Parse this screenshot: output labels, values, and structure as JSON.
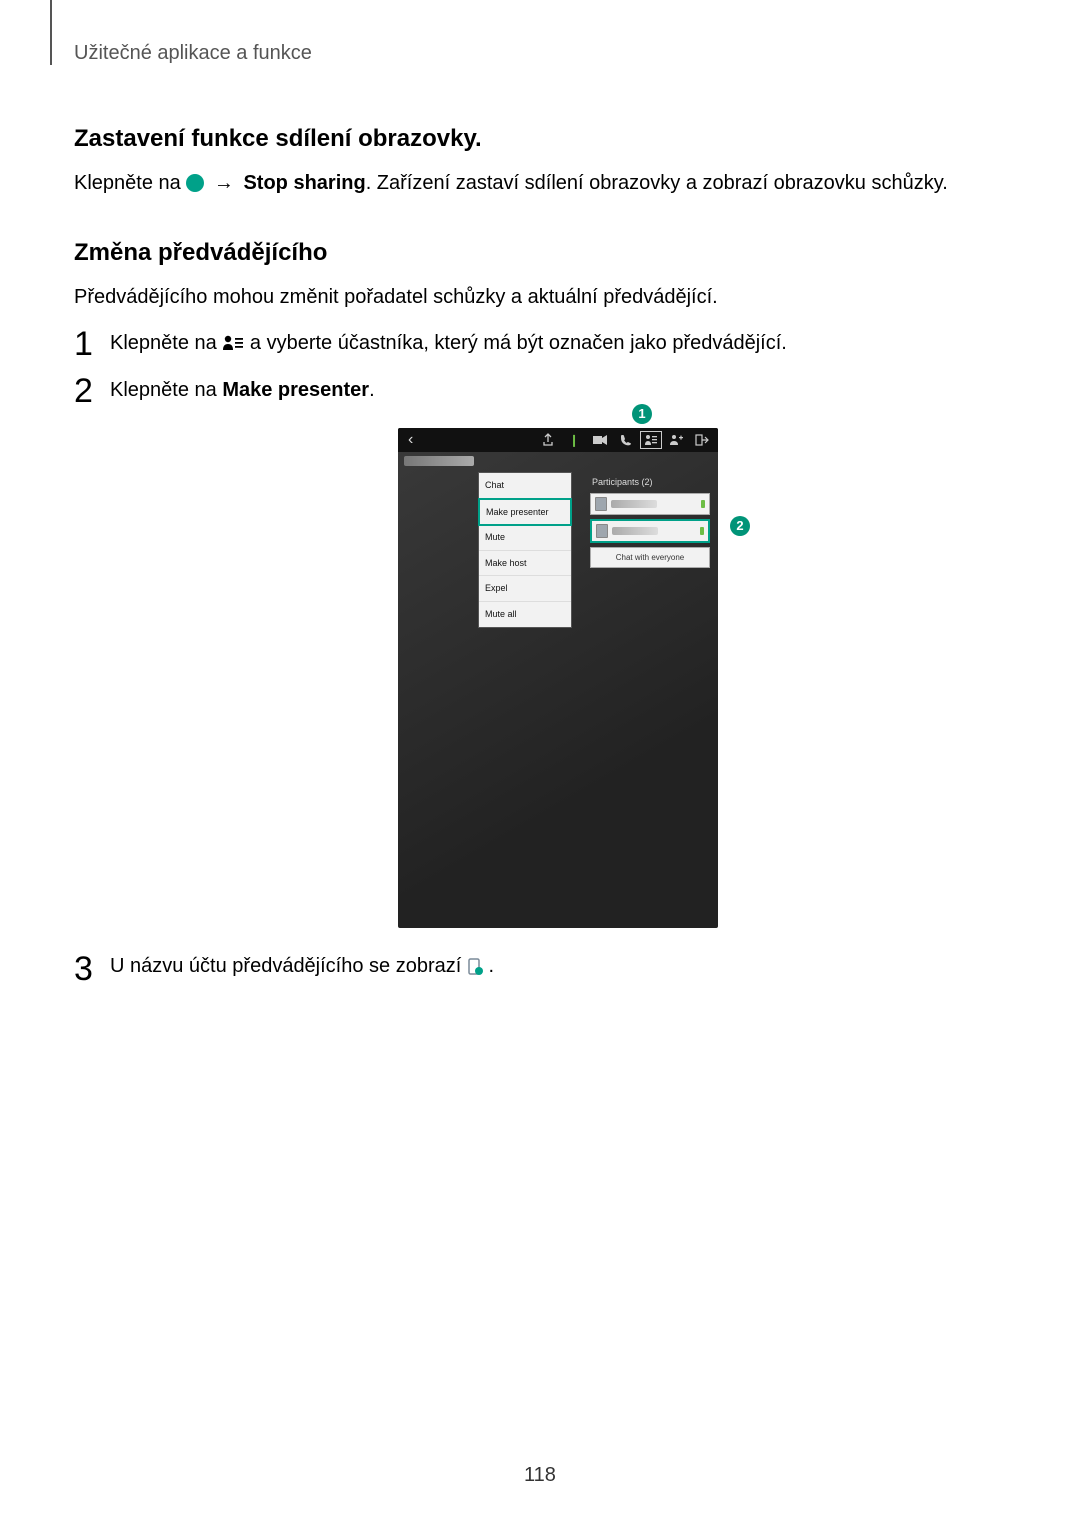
{
  "header": {
    "running_head": "Užitečné aplikace a funkce"
  },
  "section1": {
    "heading": "Zastavení funkce sdílení obrazovky.",
    "p_prefix": "Klepněte na ",
    "p_arrow": "→",
    "p_bold": " Stop sharing",
    "p_suffix": ". Zařízení zastaví sdílení obrazovky a zobrazí obrazovku schůzky."
  },
  "section2": {
    "heading": "Změna předvádějícího",
    "intro": "Předvádějícího mohou změnit pořadatel schůzky a aktuální předvádějící.",
    "step1_prefix": "Klepněte na ",
    "step1_suffix": " a vyberte účastníka, který má být označen jako předvádějící.",
    "step2_prefix": "Klepněte na ",
    "step2_bold": "Make presenter",
    "step2_suffix": ".",
    "step3_prefix": "U názvu účtu předvádějícího se zobrazí ",
    "step3_suffix": "."
  },
  "markers": {
    "m1": "1",
    "m2": "2",
    "m3": "3"
  },
  "shot": {
    "menu": {
      "chat": "Chat",
      "make_presenter": "Make presenter",
      "mute": "Mute",
      "make_host": "Make host",
      "expel": "Expel",
      "mute_all": "Mute all"
    },
    "participants_header": "Participants (2)",
    "chat_everyone": "Chat with everyone"
  },
  "page_number": "118"
}
